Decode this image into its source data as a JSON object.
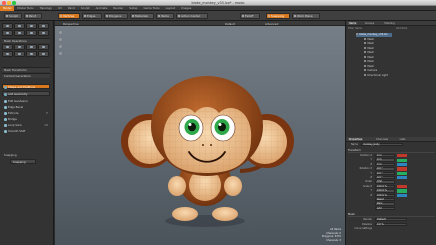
{
  "window": {
    "title": "bloke_monkey_v33.lxo* - modo",
    "traffic_colors": [
      "#ff5f57",
      "#febc2e",
      "#28c840"
    ]
  },
  "menu": {
    "items": [
      "Model",
      "Model Tools",
      "Topology",
      "UV",
      "Paint",
      "Sculpt",
      "Animate",
      "Render",
      "Setup",
      "Game Tools",
      "Layout",
      "Images"
    ],
    "active_index": 0
  },
  "toolbar": {
    "sculpt": "Sculpt",
    "paint": "Paint",
    "vertices": "Vertices",
    "edges": "Edges",
    "polygons": "Polygons",
    "materials": "Materials",
    "items": "Items",
    "action_center": "Action Center",
    "falloff": "Falloff",
    "snapping": "Snapping",
    "work_plane": "Work Plane"
  },
  "left_panel": {
    "tool_header": "Basic Tools",
    "mesh_ops_header": "Mesh Operations",
    "curves_header": "Curves",
    "section_header": "Mesh Transforms",
    "section_header2": "Content Generators",
    "shape_button": "Shape and Positions",
    "add_button": "Add Geometry",
    "list": [
      {
        "label": "Edit Geodesics",
        "value": ""
      },
      {
        "label": "Edge Bevel",
        "value": ""
      },
      {
        "label": "Extrude",
        "value": "E"
      },
      {
        "label": "Bridge",
        "value": ""
      },
      {
        "label": "Loop Slice",
        "value": "Alt"
      },
      {
        "label": "Smooth Shift",
        "value": ""
      }
    ],
    "snapping_label": "Snapping",
    "snapping_value": "Snapping"
  },
  "viewport": {
    "label": "Perspective",
    "mode": "Default",
    "shading": "Advanced",
    "info": [
      "All Items",
      "Channels: 0",
      "Polygons: 3372",
      "Channels: 3"
    ]
  },
  "right_top": {
    "tabs": [
      "Items",
      "Groups",
      "Shading"
    ],
    "active_tab": 0,
    "filter_label": "Filter Items",
    "add_item": "Add Item",
    "tree": [
      {
        "label": "bloke_monkey_v33.lxo",
        "selected": true,
        "indent": 0
      },
      {
        "label": "Mesh",
        "selected": false,
        "indent": 1
      },
      {
        "label": "Mesh",
        "selected": false,
        "indent": 1
      },
      {
        "label": "Mesh",
        "selected": false,
        "indent": 1
      },
      {
        "label": "Mesh",
        "selected": false,
        "indent": 1
      },
      {
        "label": "Mesh",
        "selected": false,
        "indent": 1
      },
      {
        "label": "Mesh",
        "selected": false,
        "indent": 1
      },
      {
        "label": "Mesh",
        "selected": false,
        "indent": 1
      },
      {
        "label": "Camera",
        "selected": false,
        "indent": 1
      },
      {
        "label": "Directional Light",
        "selected": false,
        "indent": 1
      }
    ]
  },
  "properties": {
    "tabs": [
      "Properties",
      "Channels",
      "Lists"
    ],
    "active_tab": 0,
    "name_label": "Name",
    "name_value": "monkey_body",
    "transform_header": "Transform",
    "rows": [
      {
        "label": "Position X",
        "value": "0 m",
        "swatch": "#c0392b"
      },
      {
        "label": "Y",
        "value": "0 m",
        "swatch": "#27ae60"
      },
      {
        "label": "Z",
        "value": "0 m",
        "swatch": "#2e86c1"
      },
      {
        "label": "Rotation X",
        "value": "0.0 °",
        "swatch": "#c0392b"
      },
      {
        "label": "Y",
        "value": "0.0 °",
        "swatch": "#27ae60"
      },
      {
        "label": "Z",
        "value": "0.0 °",
        "swatch": "#2e86c1"
      },
      {
        "label": "Order",
        "value": "XYZ",
        "swatch": ""
      },
      {
        "label": "Scale X",
        "value": "100.0 %",
        "swatch": "#c0392b"
      },
      {
        "label": "Y",
        "value": "100.0 %",
        "swatch": "#27ae60"
      },
      {
        "label": "Z",
        "value": "100.0 %",
        "swatch": "#2e86c1"
      },
      {
        "label": "",
        "value": "Reset",
        "swatch": ""
      },
      {
        "label": "",
        "value": "Zero",
        "swatch": ""
      },
      {
        "label": "",
        "value": "Add",
        "swatch": ""
      }
    ],
    "mesh_header": "Mesh",
    "mesh_rows": [
      {
        "label": "Render",
        "value": "Default"
      },
      {
        "label": "Dissolve",
        "value": "0.0 %"
      },
      {
        "label": "Curve Settings",
        "value": ""
      }
    ]
  }
}
